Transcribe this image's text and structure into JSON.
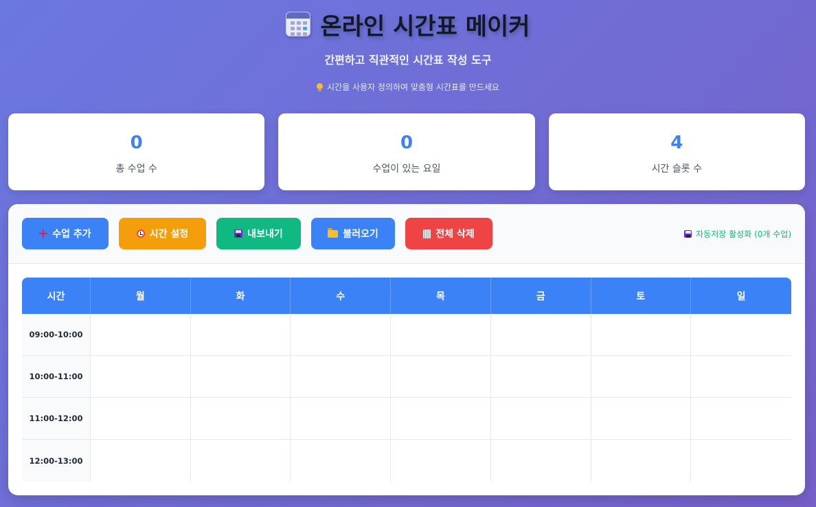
{
  "header": {
    "icon": "calendar-icon",
    "title": "온라인 시간표 메이커",
    "subtitle": "간편하고 직관적인 시간표 작성 도구",
    "hint_icon": "lightbulb-icon",
    "hint": "시간을 사용자 정의하여 맞춤형 시간표를 만드세요"
  },
  "stats": [
    {
      "value": "0",
      "label": "총 수업 수"
    },
    {
      "value": "0",
      "label": "수업이 있는 요일"
    },
    {
      "value": "4",
      "label": "시간 슬롯 수"
    }
  ],
  "toolbar": {
    "add_label": "수업 추가",
    "time_label": "시간 설정",
    "export_label": "내보내기",
    "import_label": "불러오기",
    "clear_label": "전체 삭제",
    "autosave": "자동저장 활성화 (0개 수업)"
  },
  "colors": {
    "primary": "#3b82f6",
    "warning": "#f59e0b",
    "success": "#10b981",
    "danger": "#ef4444"
  },
  "timetable": {
    "headers": [
      "시간",
      "월",
      "화",
      "수",
      "목",
      "금",
      "토",
      "일"
    ],
    "rows": [
      {
        "time": "09:00-10:00"
      },
      {
        "time": "10:00-11:00"
      },
      {
        "time": "11:00-12:00"
      },
      {
        "time": "12:00-13:00"
      }
    ]
  }
}
